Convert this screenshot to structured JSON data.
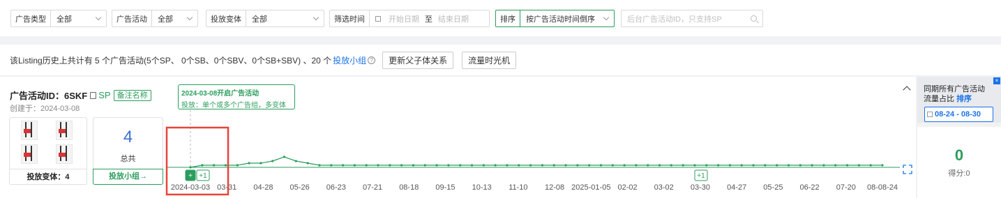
{
  "filters": {
    "ad_type": {
      "label": "广告类型",
      "value": "全部"
    },
    "ad_campaign": {
      "label": "广告活动",
      "value": "全部"
    },
    "variant": {
      "label": "投放变体",
      "value": "全部"
    },
    "time": {
      "label": "筛选时间",
      "start_placeholder": "开始日期",
      "separator": "至",
      "end_placeholder": "结束日期"
    },
    "sort": {
      "label": "排序",
      "value": "按广告活动时间倒序"
    },
    "search_placeholder": "后台广告活动ID，只支持SP"
  },
  "info": {
    "text": "该Listing历史上共计有 5 个广告活动(5个SP、 0个SB、0个SBV、0个SB+SBV) 、20 个",
    "link": "投放小组",
    "help": "?",
    "btn_parent": "更新父子体关系",
    "btn_time": "流量时光机"
  },
  "campaign": {
    "title": "广告活动ID：6SKF",
    "type": "SP",
    "remark_btn": "备注名称",
    "created": "创建于：2024-03-08",
    "variants_label": "投放变体：4",
    "group_count": "4",
    "group_count_label": "总共",
    "group_btn": "投放小组→",
    "tooltip_title": "2024-03-08开启广告活动",
    "tooltip_desc": "投放：单个或多个广告组，多变体"
  },
  "colors": {
    "accent": "#2a9d5c",
    "link": "#1a73e8",
    "highlight": "#e8443a"
  },
  "chart_data": {
    "type": "line",
    "x_ticks": [
      "2024-03-03",
      "03-31",
      "04-28",
      "05-26",
      "06-23",
      "07-21",
      "08-18",
      "09-15",
      "10-13",
      "11-10",
      "12-08",
      "2025-01-05",
      "02-02",
      "03-02",
      "03-30",
      "04-27",
      "05-25",
      "06-22",
      "07-20",
      "08-08-24"
    ],
    "markers": [
      {
        "label": "+",
        "at": "2024-03-08"
      },
      {
        "label": "+1",
        "at": "2024-03-10"
      },
      {
        "label": "+1",
        "at": "2025-03-30"
      }
    ],
    "series_values": [
      0,
      1,
      1,
      1,
      1,
      2,
      2,
      3,
      5,
      3,
      2,
      1,
      1,
      1,
      1,
      1,
      1,
      1,
      1,
      1,
      1,
      1,
      1,
      1,
      1,
      1,
      1,
      1,
      1,
      1,
      1,
      1,
      1,
      1,
      1,
      1,
      1,
      1,
      1,
      1,
      1,
      1,
      1,
      1,
      1,
      1,
      1,
      1,
      1,
      1,
      1,
      1,
      1,
      1,
      1,
      1,
      1,
      1,
      1,
      1
    ],
    "ylim": [
      0,
      10
    ]
  },
  "side": {
    "title_line1": "同期所有广告活动",
    "title_line2": "流量占比",
    "sort_label": "排序",
    "close": "×",
    "date_range": "08-24 - 08-30",
    "score": "0",
    "score_label": "得分:0"
  }
}
